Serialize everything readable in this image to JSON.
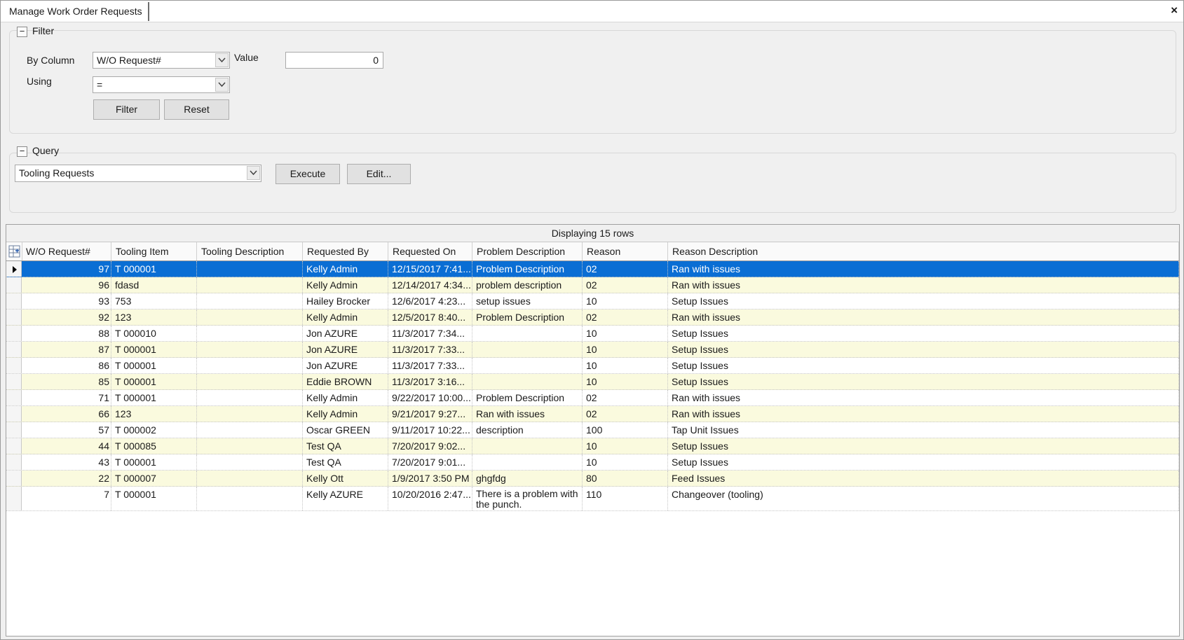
{
  "window": {
    "tab_title": "Manage Work Order Requests",
    "close_glyph": "×"
  },
  "filter": {
    "group_label": "Filter",
    "collapse_glyph": "−",
    "by_column_label": "By Column",
    "by_column_value": "W/O Request#",
    "value_label": "Value",
    "value_value": "0",
    "using_label": "Using",
    "using_value": "=",
    "filter_button": "Filter",
    "reset_button": "Reset"
  },
  "query": {
    "group_label": "Query",
    "collapse_glyph": "−",
    "selected_query": "Tooling Requests",
    "execute_button": "Execute",
    "edit_button": "Edit..."
  },
  "grid": {
    "caption": "Displaying 15 rows",
    "columns": [
      "W/O Request#",
      "Tooling Item",
      "Tooling Description",
      "Requested By",
      "Requested On",
      "Problem Description",
      "Reason",
      "Reason Description"
    ],
    "rows": [
      {
        "wo": "97",
        "item": "T 000001",
        "desc": "",
        "by": "Kelly Admin",
        "on": "12/15/2017 7:41...",
        "problem": "Problem Description",
        "reason": "02",
        "reason_desc": "Ran with issues"
      },
      {
        "wo": "96",
        "item": "fdasd",
        "desc": "",
        "by": "Kelly Admin",
        "on": "12/14/2017 4:34...",
        "problem": "problem description",
        "reason": "02",
        "reason_desc": "Ran with issues"
      },
      {
        "wo": "93",
        "item": "753",
        "desc": "",
        "by": "Hailey Brocker",
        "on": "12/6/2017 4:23...",
        "problem": "setup issues",
        "reason": "10",
        "reason_desc": "Setup Issues"
      },
      {
        "wo": "92",
        "item": "123",
        "desc": "",
        "by": "Kelly Admin",
        "on": "12/5/2017 8:40...",
        "problem": "Problem Description",
        "reason": "02",
        "reason_desc": "Ran with issues"
      },
      {
        "wo": "88",
        "item": "T 000010",
        "desc": "",
        "by": "Jon AZURE",
        "on": "11/3/2017 7:34...",
        "problem": "",
        "reason": "10",
        "reason_desc": "Setup Issues"
      },
      {
        "wo": "87",
        "item": "T 000001",
        "desc": "",
        "by": "Jon AZURE",
        "on": "11/3/2017 7:33...",
        "problem": "",
        "reason": "10",
        "reason_desc": "Setup Issues"
      },
      {
        "wo": "86",
        "item": "T 000001",
        "desc": "",
        "by": "Jon AZURE",
        "on": "11/3/2017 7:33...",
        "problem": "",
        "reason": "10",
        "reason_desc": "Setup Issues"
      },
      {
        "wo": "85",
        "item": "T 000001",
        "desc": "",
        "by": "Eddie BROWN",
        "on": "11/3/2017 3:16...",
        "problem": "",
        "reason": "10",
        "reason_desc": "Setup Issues"
      },
      {
        "wo": "71",
        "item": "T 000001",
        "desc": "",
        "by": "Kelly Admin",
        "on": "9/22/2017 10:00...",
        "problem": "Problem Description",
        "reason": "02",
        "reason_desc": "Ran with issues"
      },
      {
        "wo": "66",
        "item": "123",
        "desc": "",
        "by": "Kelly Admin",
        "on": "9/21/2017 9:27...",
        "problem": "Ran with issues",
        "reason": "02",
        "reason_desc": "Ran with issues"
      },
      {
        "wo": "57",
        "item": "T 000002",
        "desc": "",
        "by": "Oscar GREEN",
        "on": "9/11/2017 10:22...",
        "problem": "description",
        "reason": "100",
        "reason_desc": "Tap Unit Issues"
      },
      {
        "wo": "44",
        "item": "T 000085",
        "desc": "",
        "by": "Test QA",
        "on": "7/20/2017 9:02...",
        "problem": "",
        "reason": "10",
        "reason_desc": "Setup Issues"
      },
      {
        "wo": "43",
        "item": "T 000001",
        "desc": "",
        "by": "Test QA",
        "on": "7/20/2017 9:01...",
        "problem": "",
        "reason": "10",
        "reason_desc": "Setup Issues"
      },
      {
        "wo": "22",
        "item": "T 000007",
        "desc": "",
        "by": "Kelly Ott",
        "on": "1/9/2017 3:50 PM",
        "problem": "ghgfdg",
        "reason": "80",
        "reason_desc": "Feed Issues"
      },
      {
        "wo": "7",
        "item": "T 000001",
        "desc": "",
        "by": "Kelly AZURE",
        "on": "10/20/2016 2:47...",
        "problem": "There is a problem with the punch.",
        "reason": "110",
        "reason_desc": "Changeover (tooling)"
      }
    ]
  },
  "colors": {
    "selected_row": "#0a6ed4",
    "alt_row": "#fafade"
  },
  "icons": [
    "close-icon",
    "collapse-icon",
    "dropdown-arrow-icon",
    "column-chooser-icon",
    "row-pointer-icon"
  ]
}
